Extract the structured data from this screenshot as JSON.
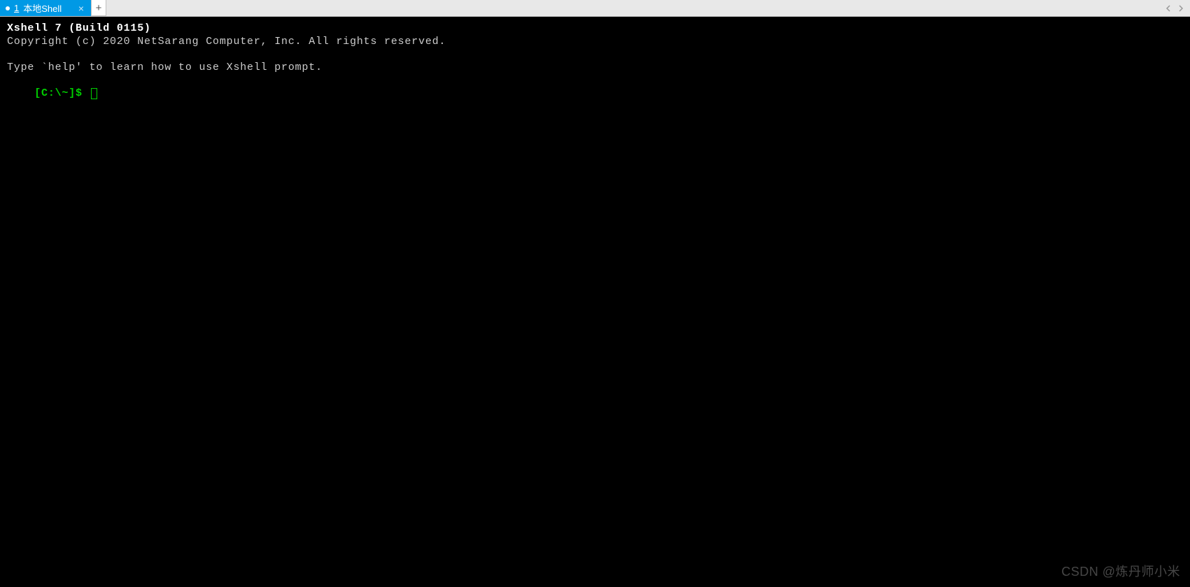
{
  "tabs": {
    "active": {
      "number": "1",
      "label": "本地Shell",
      "close_glyph": "×"
    },
    "add_glyph": "+"
  },
  "nav": {
    "left_glyph": "◀",
    "right_glyph": "▶"
  },
  "terminal": {
    "header_bold": "Xshell 7 (Build 0115)",
    "copyright": "Copyright (c) 2020 NetSarang Computer, Inc. All rights reserved.",
    "help_line": "Type `help' to learn how to use Xshell prompt.",
    "prompt": "[C:\\~]$ "
  },
  "watermark": "CSDN @炼丹师小米",
  "colors": {
    "tab_active_bg": "#0099e5",
    "terminal_bg": "#000000",
    "prompt_color": "#00d000"
  }
}
